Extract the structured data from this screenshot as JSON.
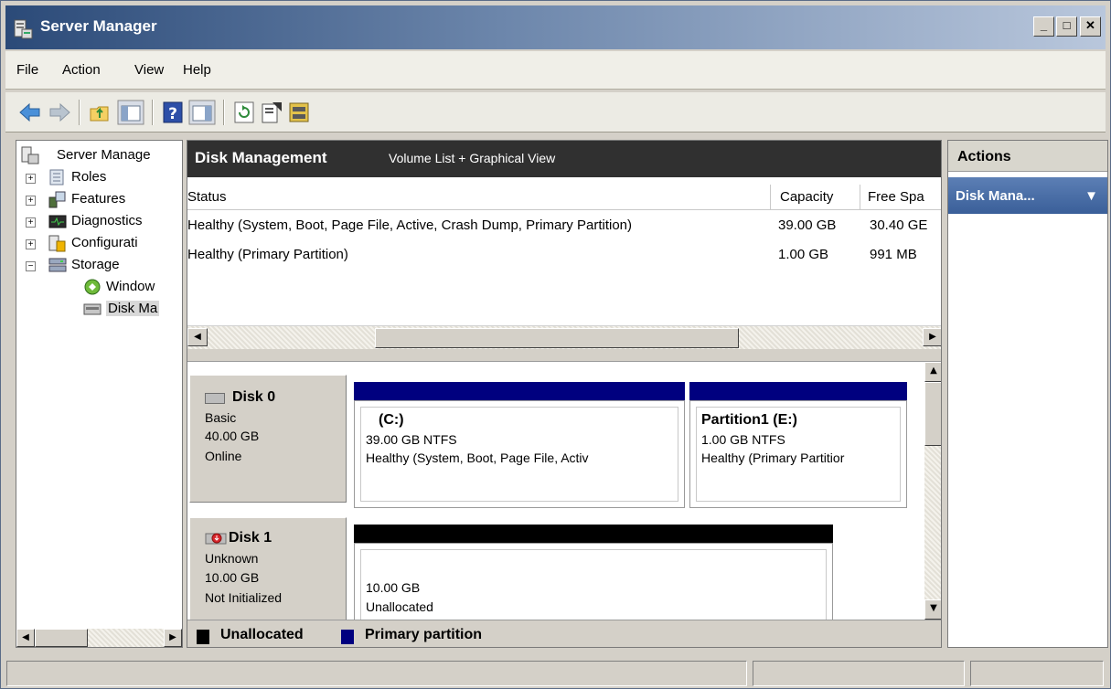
{
  "window": {
    "title": "Server Manager",
    "min_btn": "_",
    "max_btn": "□",
    "close_btn": "✕"
  },
  "menu": {
    "items": [
      "File",
      "Action",
      "View",
      "Help"
    ]
  },
  "toolbar": {
    "icons": [
      "back-icon",
      "forward-icon",
      "up-folder-icon",
      "show-hide-tree-icon",
      "help-icon",
      "show-hide-action-pane-icon",
      "refresh-icon",
      "properties-icon",
      "disk-icon"
    ]
  },
  "tree": {
    "items": [
      {
        "label": "Server Manage",
        "icon": "server-icon"
      },
      {
        "label": "Roles",
        "icon": "roles-icon",
        "expander": "+"
      },
      {
        "label": "Features",
        "icon": "features-icon",
        "expander": "+"
      },
      {
        "label": "Diagnostics",
        "icon": "diagnostics-icon",
        "expander": "+"
      },
      {
        "label": "Configurati",
        "icon": "configuration-icon",
        "expander": "+"
      },
      {
        "label": "Storage",
        "icon": "storage-icon",
        "expander": "−"
      },
      {
        "label": "Window",
        "icon": "windows-backup-icon"
      },
      {
        "label": "Disk Ma",
        "icon": "disk-management-icon"
      }
    ]
  },
  "center": {
    "heading": "Disk Management",
    "subheading": "Volume List + Graphical View",
    "volume_list": {
      "columns": [
        "Status",
        "Capacity",
        "Free Spa"
      ],
      "rows": [
        [
          "Healthy (System, Boot, Page File, Active, Crash Dump, Primary Partition)",
          "39.00 GB",
          "30.40 GE"
        ],
        [
          "Healthy (Primary Partition)",
          "1.00 GB",
          "991 MB"
        ]
      ]
    },
    "disks": [
      {
        "name": "Disk 0",
        "type": "Basic",
        "size": "40.00 GB",
        "state": "Online",
        "partitions": [
          {
            "name": "(C:)",
            "fs": "39.00 GB NTFS",
            "status": "Healthy (System, Boot, Page File, Activ",
            "bar_color": "#00007f"
          },
          {
            "name": "Partition1  (E:)",
            "fs": "1.00 GB NTFS",
            "status": "Healthy (Primary Partitior",
            "bar_color": "#00007f"
          }
        ]
      },
      {
        "name": "Disk 1",
        "type": "Unknown",
        "size": "10.00 GB",
        "state": "Not Initialized",
        "partitions": [
          {
            "size": "10.00 GB",
            "status": "Unallocated",
            "bar_color": "#000000"
          }
        ]
      }
    ],
    "legend": [
      {
        "label": "Unallocated",
        "color": "#000000"
      },
      {
        "label": "Primary partition",
        "color": "#00007f"
      }
    ]
  },
  "actions": {
    "heading": "Actions",
    "selected": "Disk Mana...",
    "chevron": "▼"
  },
  "colors": {
    "primary_partition": "#00007f",
    "unallocated": "#000000",
    "header_dark": "#303030",
    "action_selected": "#3a5f99"
  }
}
